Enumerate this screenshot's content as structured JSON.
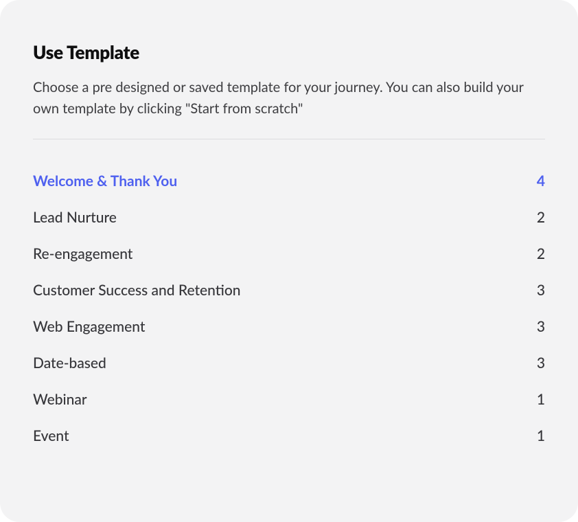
{
  "header": {
    "title": "Use Template",
    "description": "Choose a pre designed or saved template for your journey. You can also build your own template by clicking \"Start from scratch\""
  },
  "categories": [
    {
      "label": "Welcome & Thank You",
      "count": 4,
      "active": true
    },
    {
      "label": "Lead Nurture",
      "count": 2,
      "active": false
    },
    {
      "label": "Re-engagement",
      "count": 2,
      "active": false
    },
    {
      "label": "Customer Success and Retention",
      "count": 3,
      "active": false
    },
    {
      "label": "Web Engagement",
      "count": 3,
      "active": false
    },
    {
      "label": "Date-based",
      "count": 3,
      "active": false
    },
    {
      "label": "Webinar",
      "count": 1,
      "active": false
    },
    {
      "label": "Event",
      "count": 1,
      "active": false
    }
  ]
}
